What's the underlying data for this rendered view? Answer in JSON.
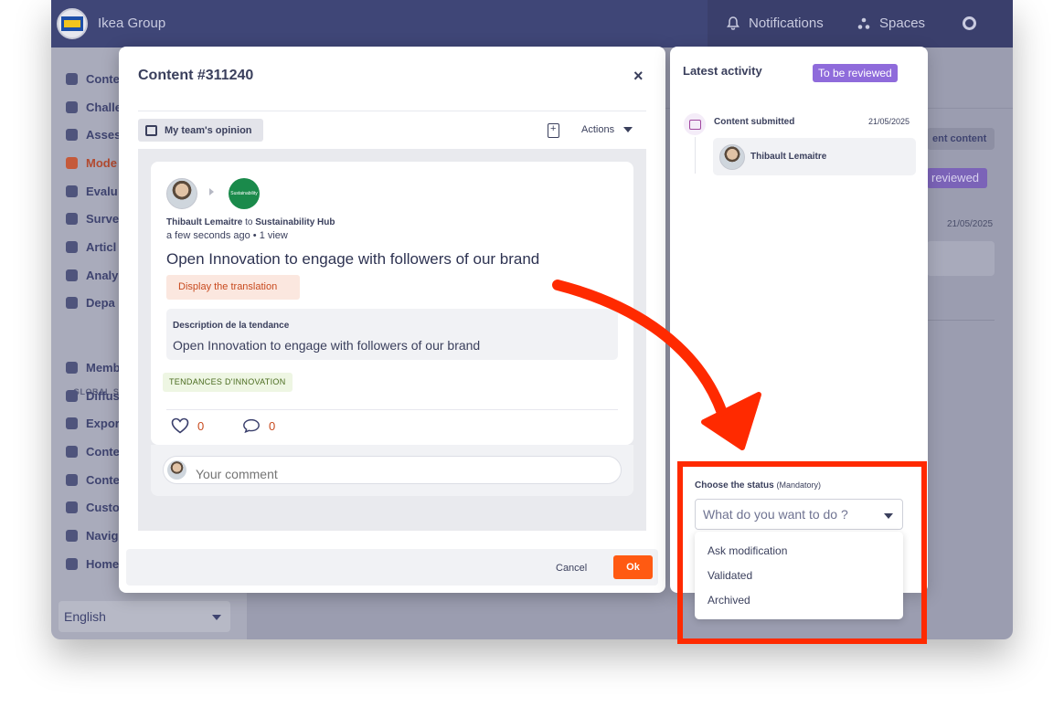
{
  "topbar": {
    "org_name": "Ikea Group",
    "notifications_label": "Notifications",
    "spaces_label": "Spaces",
    "logo_text": "IKEA"
  },
  "sidebar": {
    "items": [
      {
        "label": "Conte",
        "icon": "bulb-icon"
      },
      {
        "label": "Challe",
        "icon": "trophy-icon"
      },
      {
        "label": "Asses",
        "icon": "tag-icon"
      },
      {
        "label": "Mode",
        "icon": "moderation-icon"
      },
      {
        "label": "Evalu",
        "icon": "star-icon"
      },
      {
        "label": "Surve",
        "icon": "bar-chart-icon"
      },
      {
        "label": "Articl",
        "icon": "article-icon"
      },
      {
        "label": "Analy",
        "icon": "analytics-icon"
      },
      {
        "label": "Depa",
        "icon": "user-icon"
      }
    ],
    "section_label": "GLOBAL SE",
    "global_items": [
      {
        "label": "Memb",
        "icon": "members-icon"
      },
      {
        "label": "Diffus",
        "icon": "diffusion-icon"
      },
      {
        "label": "Expor",
        "icon": "export-icon"
      },
      {
        "label": "Conte",
        "icon": "list-icon"
      },
      {
        "label": "Conte",
        "icon": "edit-icon"
      },
      {
        "label": "Custo",
        "icon": "layers-icon"
      },
      {
        "label": "Navig",
        "icon": "menu-icon"
      },
      {
        "label": "Home",
        "icon": "home-icon"
      }
    ],
    "language": "English"
  },
  "background": {
    "button_text": "ent content",
    "badge_text": "reviewed",
    "date": "21/05/2025"
  },
  "modal": {
    "title": "Content #311240",
    "close_glyph": "×",
    "opinion_tab": "My team's opinion",
    "actions_label": "Actions",
    "card": {
      "author": "Thibault Lemaitre",
      "to_word": "to",
      "target": "Sustainability Hub",
      "hub_logo_text": "Sustainability",
      "meta": "a few seconds ago • 1 view",
      "title": "Open Innovation to engage with followers of our brand",
      "translate_label": "Display the translation",
      "desc_label": "Description de la tendance",
      "desc_text": "Open Innovation to engage with followers of our brand",
      "tag": "TENDANCES D'INNOVATION",
      "likes": "0",
      "comments": "0",
      "comment_placeholder": "Your comment"
    },
    "cancel_label": "Cancel",
    "ok_label": "Ok"
  },
  "activity": {
    "title": "Latest activity",
    "status_badge": "To be reviewed",
    "event_label": "Content submitted",
    "event_date": "21/05/2025",
    "event_user": "Thibault Lemaitre"
  },
  "status": {
    "label": "Choose the status",
    "mandatory": "(Mandatory)",
    "placeholder": "What do you want to do ?",
    "options": [
      "Ask modification",
      "Validated",
      "Archived"
    ]
  },
  "colors": {
    "accent_orange": "#ff5a12",
    "purple_badge": "#8f6bdb",
    "annotation_red": "#ff2a00",
    "topbar": "#3f4677"
  }
}
